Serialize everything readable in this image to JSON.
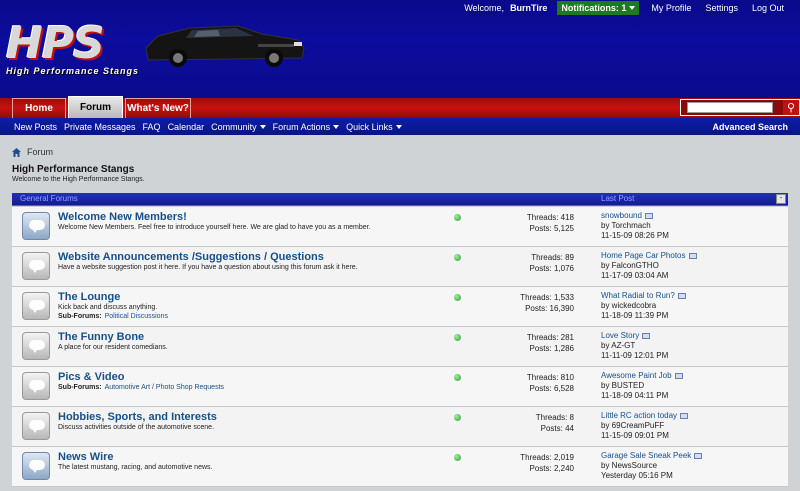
{
  "header": {
    "welcome": "Welcome,",
    "username": "BurnTire",
    "notifications": "Notifications: 1",
    "links": [
      "My Profile",
      "Settings",
      "Log Out"
    ],
    "logo_text": "HPS",
    "logo_sub": "High Performance Stangs"
  },
  "nav": {
    "tabs": [
      "Home",
      "Forum",
      "What's New?"
    ],
    "active_tab": "Forum",
    "search_placeholder": "",
    "subnav": [
      "New Posts",
      "Private Messages",
      "FAQ",
      "Calendar",
      "Community",
      "Forum Actions",
      "Quick Links"
    ],
    "advanced_search": "Advanced Search"
  },
  "breadcrumb": "Forum",
  "page": {
    "title": "High Performance Stangs",
    "description": "Welcome to the High Performance Stangs."
  },
  "table_header": {
    "col1": "General Forums",
    "col2": "Last Post",
    "collapse": "-"
  },
  "forums": [
    {
      "title": "Welcome New Members!",
      "desc": "Welcome New Members. Feel free to introduce yourself here. We are glad to have you as a member.",
      "sub_label": "",
      "sub_forums": "",
      "threads": "Threads: 418",
      "posts": "Posts: 5,125",
      "last_title": "snowbound",
      "last_by": "by Torchmach",
      "last_time": "11-15-09 08:26 PM",
      "icon": "blue"
    },
    {
      "title": "Website Announcements /Suggestions / Questions",
      "desc": "Have a website suggestion post it here. If you have a question about using this forum ask it here.",
      "sub_label": "",
      "sub_forums": "",
      "threads": "Threads: 89",
      "posts": "Posts: 1,076",
      "last_title": "Home Page Car Photos",
      "last_by": "by FalconGTHO",
      "last_time": "11-17-09 03:04 AM",
      "icon": "gray"
    },
    {
      "title": "The Lounge",
      "desc": "Kick back and discuss anything.",
      "sub_label": "Sub-Forums:",
      "sub_forums": "Political Discussions",
      "threads": "Threads: 1,533",
      "posts": "Posts: 16,390",
      "last_title": "What Radial to Run?",
      "last_by": "by wickedcobra",
      "last_time": "11-18-09 11:39 PM",
      "icon": "gray"
    },
    {
      "title": "The Funny Bone",
      "desc": "A place for our resident comedians.",
      "sub_label": "",
      "sub_forums": "",
      "threads": "Threads: 281",
      "posts": "Posts: 1,286",
      "last_title": "Love Story",
      "last_by": "by AZ-GT",
      "last_time": "11-11-09 12:01 PM",
      "icon": "gray"
    },
    {
      "title": "Pics & Video",
      "desc": "",
      "sub_label": "Sub-Forums:",
      "sub_forums": "Automotive Art / Photo Shop Requests",
      "threads": "Threads: 810",
      "posts": "Posts: 6,528",
      "last_title": "Awesome Paint Job",
      "last_by": "by BUSTED",
      "last_time": "11-18-09 04:11 PM",
      "icon": "gray"
    },
    {
      "title": "Hobbies, Sports, and Interests",
      "desc": "Discuss activities outside of the automotive scene.",
      "sub_label": "",
      "sub_forums": "",
      "threads": "Threads: 8",
      "posts": "Posts: 44",
      "last_title": "Little RC action today",
      "last_by": "by 69CreamPuFF",
      "last_time": "11-15-09 09:01 PM",
      "icon": "gray"
    },
    {
      "title": "News Wire",
      "desc": "The latest mustang, racing, and automotive news.",
      "sub_label": "",
      "sub_forums": "",
      "threads": "Threads: 2,019",
      "posts": "Posts: 2,240",
      "last_title": "Garage Sale Sneak Peek",
      "last_by": "by NewsSource",
      "last_time": "Yesterday 05:16 PM",
      "icon": "blue"
    }
  ],
  "colors": {
    "header_bg": "#0c0c9e",
    "nav_red": "#c91212",
    "link_blue": "#16508a",
    "notif_green": "#1d7a1d"
  }
}
